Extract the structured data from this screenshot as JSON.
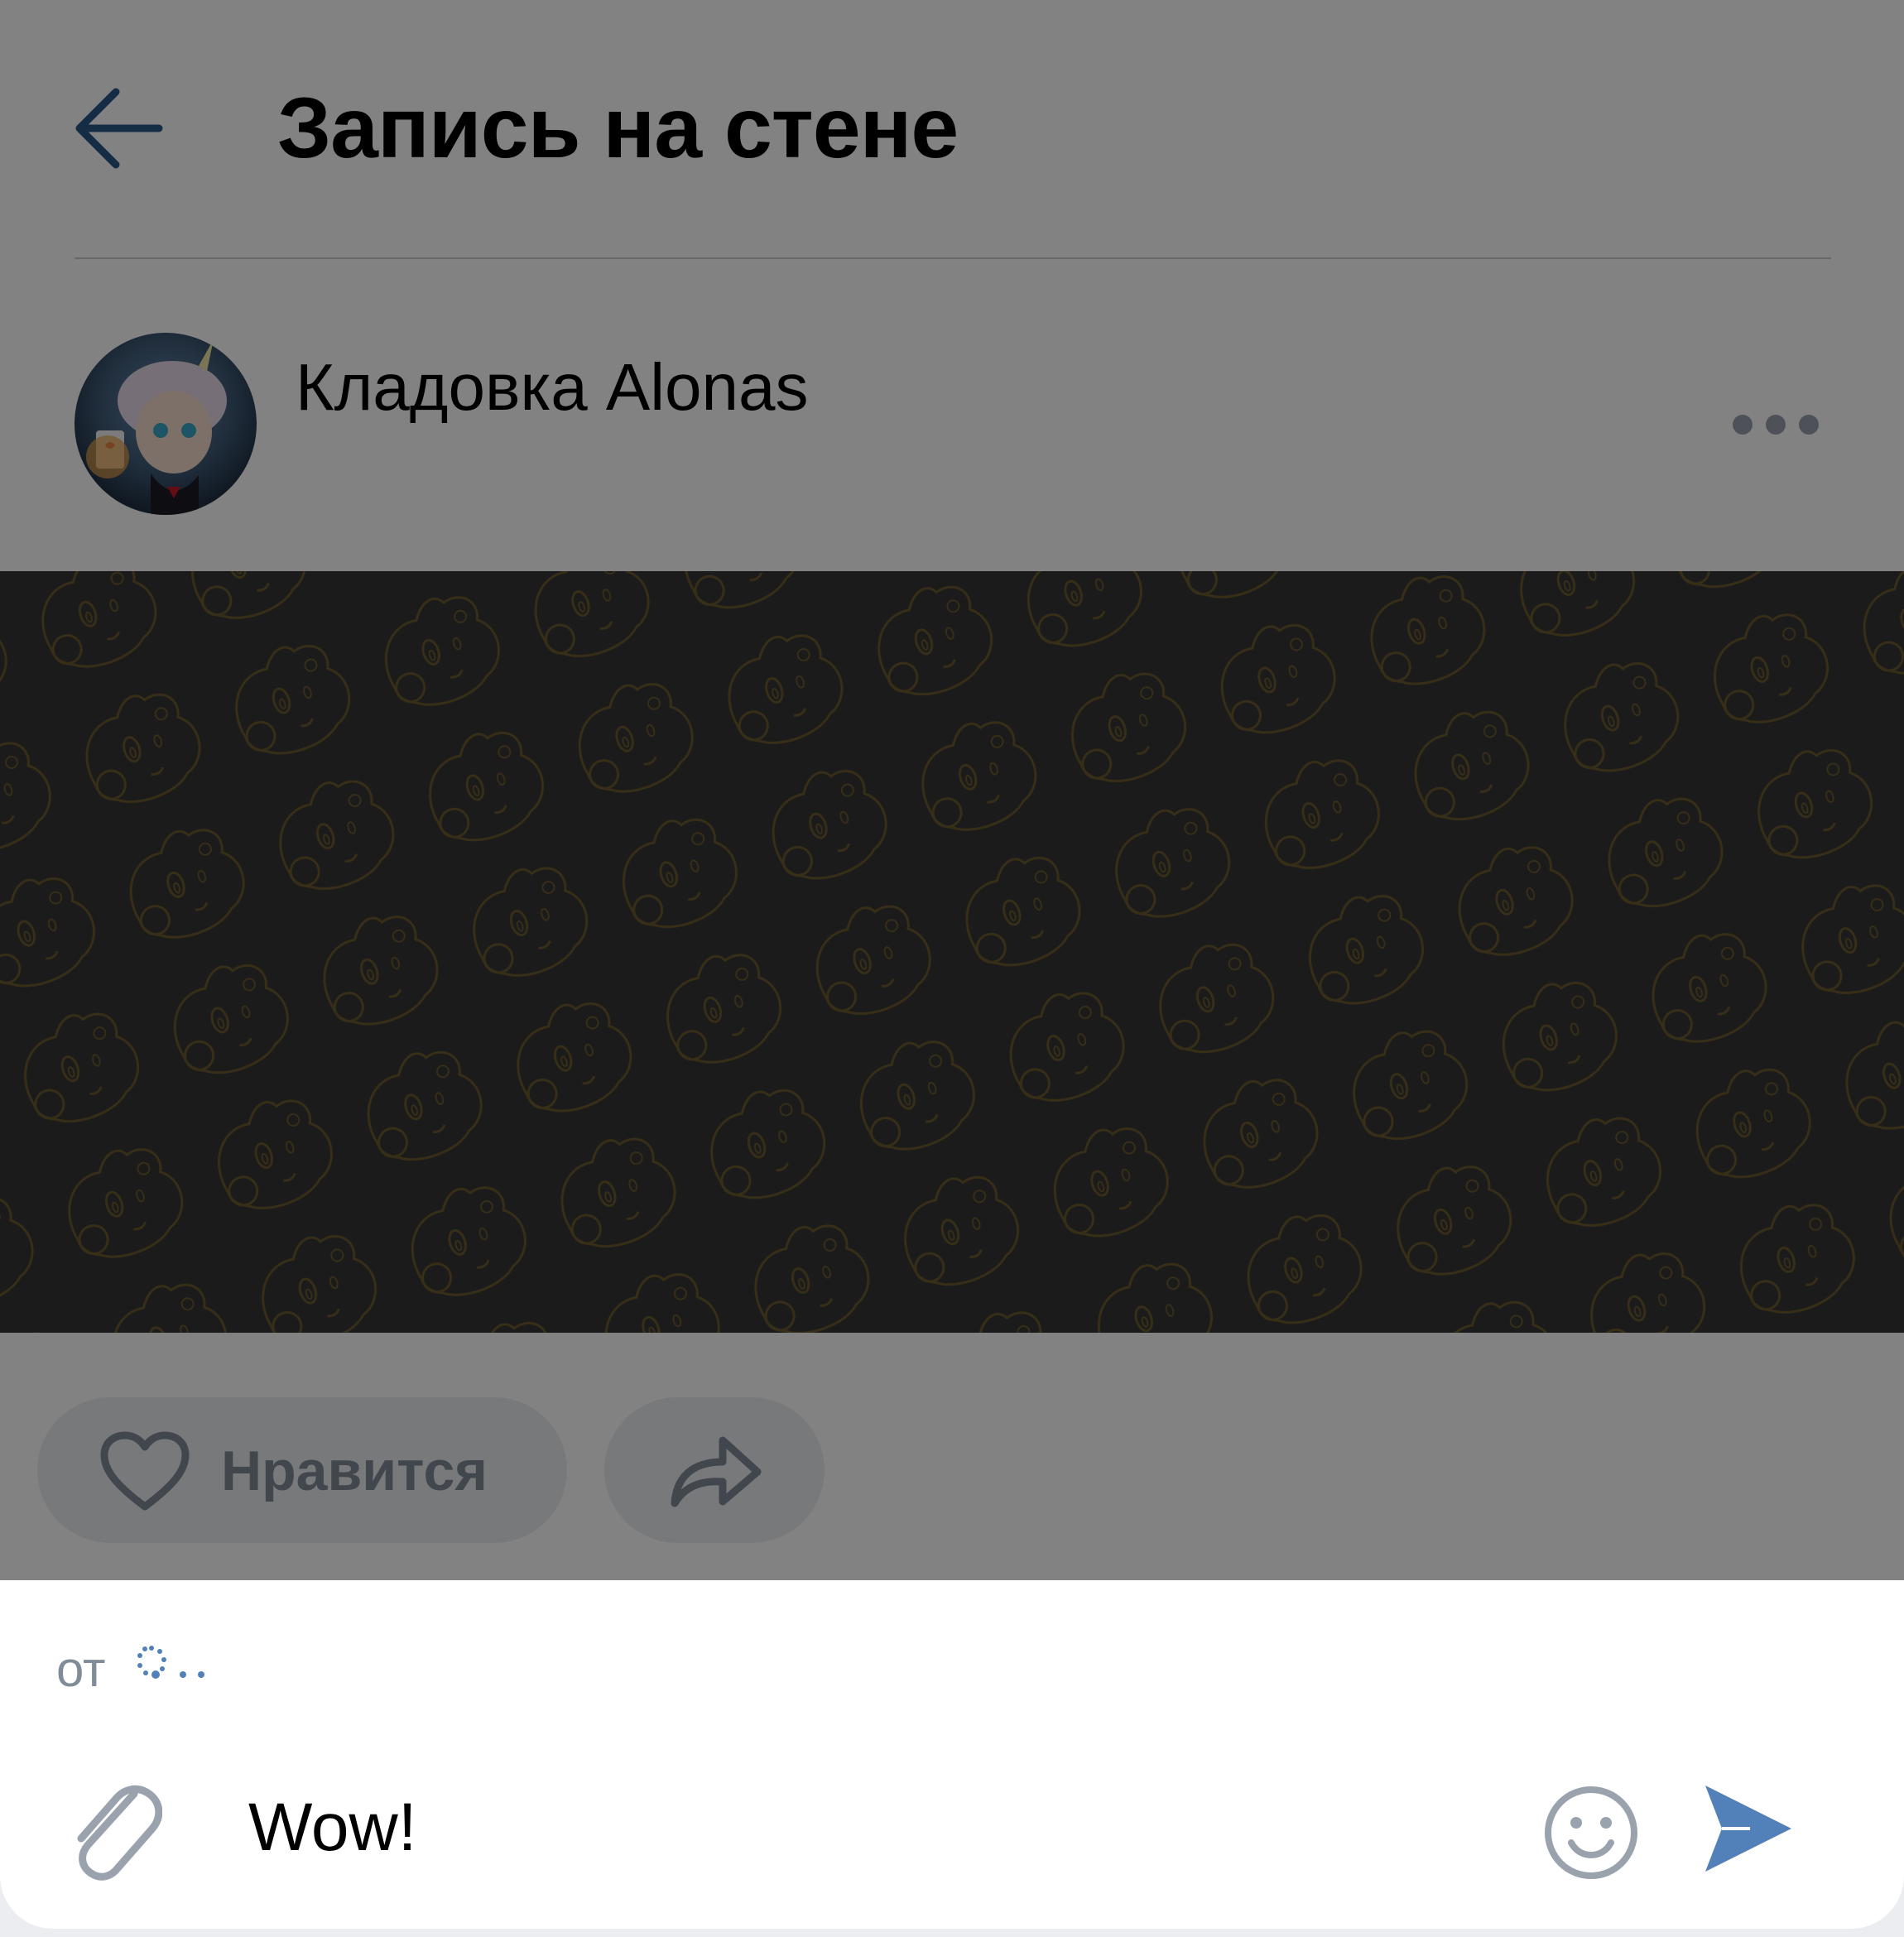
{
  "header": {
    "title": "Запись на стене"
  },
  "post": {
    "author": "Кладовка Alonas",
    "actions": {
      "like_label": "Нравится"
    }
  },
  "composer": {
    "from_label": "от",
    "input_value": "Wow!"
  },
  "colors": {
    "accent_blue": "#2a5885",
    "send_blue": "#5181b8",
    "icon_gray": "#99a2ad",
    "image_bg": "#353535",
    "pattern_line": "#6b5a2e"
  },
  "icons": {
    "back": "arrow-left-icon",
    "more": "more-horizontal-icon",
    "like": "heart-icon",
    "share": "share-icon",
    "attach": "paperclip-icon",
    "emoji": "smile-icon",
    "send": "send-icon",
    "loading": "spinner-icon"
  }
}
